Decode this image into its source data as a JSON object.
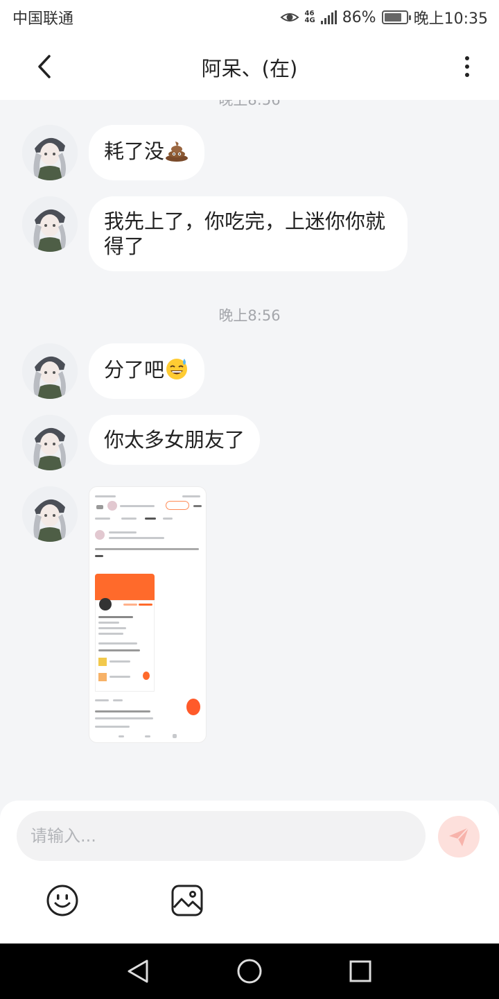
{
  "status_bar": {
    "carrier": "中国联通",
    "network": [
      "4G",
      "46"
    ],
    "battery": "86%",
    "time": "晚上10:35",
    "icons": [
      "eye-icon",
      "signal-icon",
      "battery-icon"
    ]
  },
  "header": {
    "title": "阿呆、(在)",
    "back_icon": "chevron-left-icon",
    "more_icon": "more-vertical-icon"
  },
  "chat": {
    "top_timestamp_partial": "晚上8:56",
    "messages_group1": [
      {
        "text": "耗了没",
        "emoji": "poop-emoji"
      },
      {
        "text": "我先上了，你吃完，上迷你你就得了"
      }
    ],
    "timestamp": "晚上8:56",
    "messages_group2": [
      {
        "text": "分了吧",
        "emoji": "sweat-smile-emoji"
      },
      {
        "text": "你太多女朋友了"
      }
    ],
    "image_message": {
      "type": "screenshot-image"
    }
  },
  "input_bar": {
    "placeholder": "请输入...",
    "send_icon": "send-icon",
    "tools": [
      "smiley-icon",
      "image-icon"
    ]
  },
  "nav_bar": {
    "buttons": [
      "back-triangle-icon",
      "home-circle-icon",
      "recents-square-icon"
    ]
  },
  "colors": {
    "background": "#f4f5f7",
    "bubble": "#ffffff",
    "accent_send": "#fde0dc",
    "orange": "#ff6a2b"
  }
}
